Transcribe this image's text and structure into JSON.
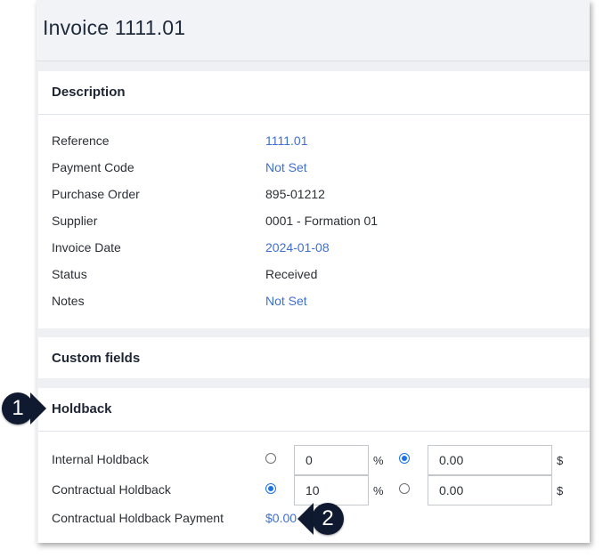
{
  "header": {
    "title": "Invoice 1111.01"
  },
  "description": {
    "title": "Description",
    "rows": [
      {
        "label": "Reference",
        "value": "1111.01"
      },
      {
        "label": "Payment Code",
        "value": "Not Set"
      },
      {
        "label": "Purchase Order",
        "value": "895-01212"
      },
      {
        "label": "Supplier",
        "value": "0001 - Formation 01"
      },
      {
        "label": "Invoice Date",
        "value": "2024-01-08"
      },
      {
        "label": "Status",
        "value": "Received"
      },
      {
        "label": "Notes",
        "value": "Not Set"
      }
    ]
  },
  "custom_fields": {
    "title": "Custom fields"
  },
  "holdback": {
    "title": "Holdback",
    "internal": {
      "label": "Internal Holdback",
      "percent_value": "0",
      "percent_unit": "%",
      "percent_selected": false,
      "amount_value": "0.00",
      "amount_unit": "$",
      "amount_selected": true
    },
    "contractual": {
      "label": "Contractual Holdback",
      "percent_value": "10",
      "percent_unit": "%",
      "percent_selected": true,
      "amount_value": "0.00",
      "amount_unit": "$",
      "amount_selected": false
    },
    "payment": {
      "label": "Contractual Holdback Payment",
      "value": "$0.00"
    }
  },
  "callouts": {
    "one": "1",
    "two": "2"
  },
  "colors": {
    "link": "#3f6fd0",
    "radio_accent": "#1a73e8",
    "callout_bg": "#0f1a30"
  }
}
